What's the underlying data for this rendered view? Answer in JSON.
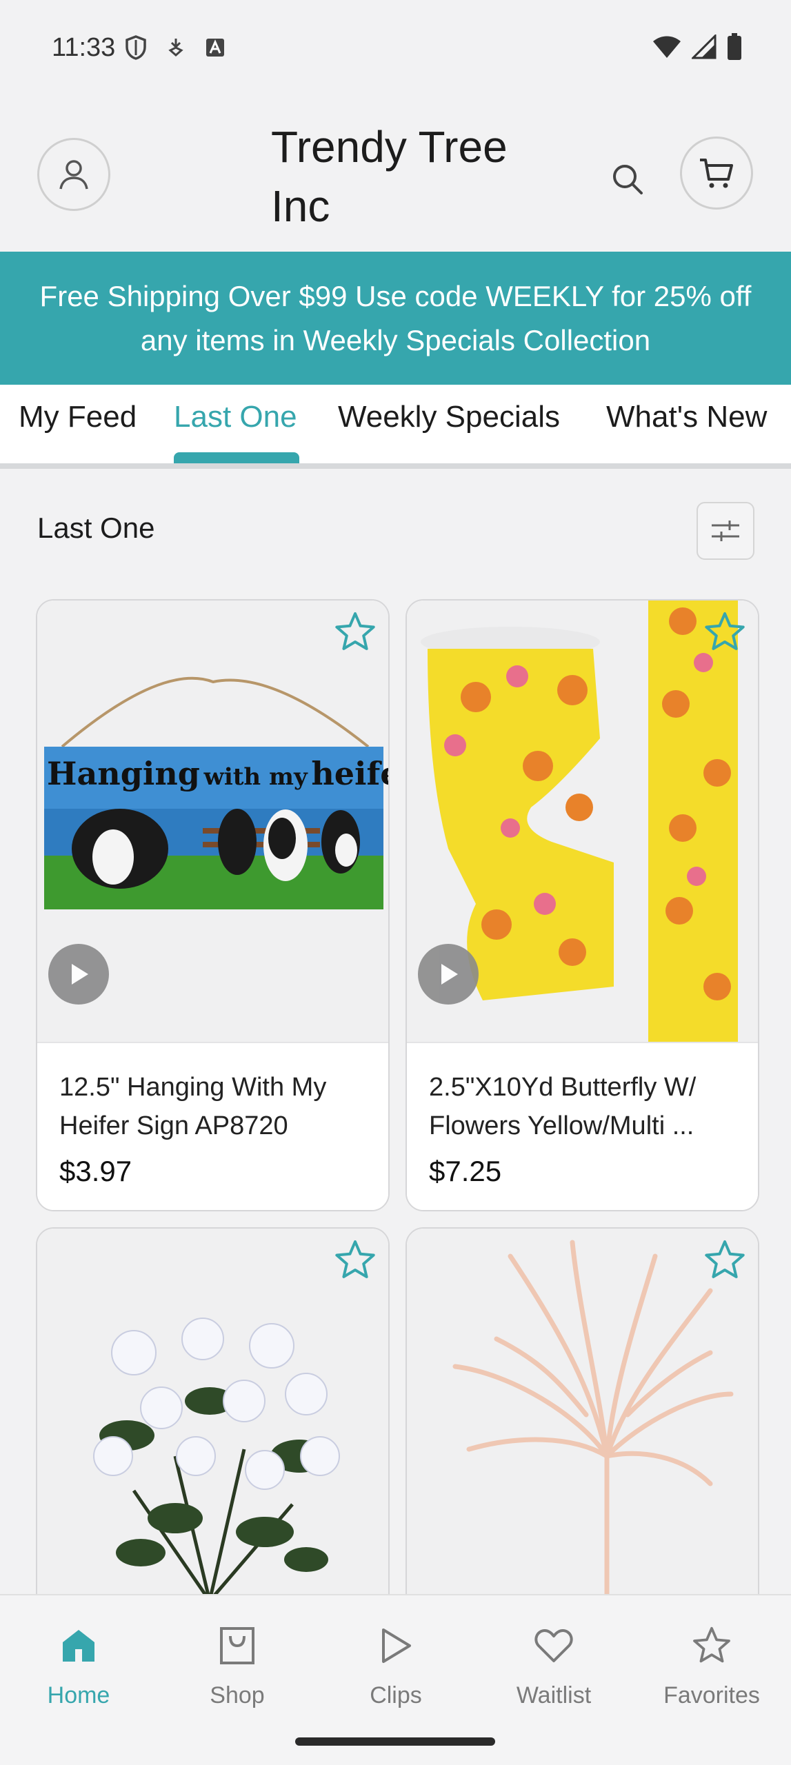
{
  "status_bar": {
    "time": "11:33",
    "left_icons": [
      "shield-icon",
      "download-badge-icon",
      "a-badge-icon"
    ],
    "right_icons": [
      "wifi-icon",
      "signal-icon",
      "battery-icon"
    ]
  },
  "header": {
    "brand": "Trendy Tree Inc",
    "icons": [
      "account-icon",
      "search-icon",
      "cart-icon"
    ]
  },
  "promo": {
    "text": "Free Shipping Over $99 Use code WEEKLY for 25% off any items in Weekly Specials Collection"
  },
  "tabs": [
    {
      "label": "My Feed",
      "active": false
    },
    {
      "label": "Last One",
      "active": true
    },
    {
      "label": "Weekly Specials",
      "active": false
    },
    {
      "label": "What's New",
      "active": false
    }
  ],
  "section": {
    "title": "Last One",
    "filter_icon": "sliders-icon"
  },
  "products": [
    {
      "name": "12.5\" Hanging With My Heifer Sign AP8720",
      "price": "$3.97",
      "sign_text_1": "Hanging",
      "sign_text_2": "with my",
      "sign_text_3": "heifers"
    },
    {
      "name": "2.5\"X10Yd Butterfly W/ Flowers Yellow/Multi ...",
      "price": "$7.25"
    },
    {
      "name": "",
      "price": ""
    },
    {
      "name": "",
      "price": ""
    }
  ],
  "bottom_nav": [
    {
      "label": "Home",
      "icon": "home-icon",
      "active": true
    },
    {
      "label": "Shop",
      "icon": "bag-icon",
      "active": false
    },
    {
      "label": "Clips",
      "icon": "play-icon",
      "active": false
    },
    {
      "label": "Waitlist",
      "icon": "heart-icon",
      "active": false
    },
    {
      "label": "Favorites",
      "icon": "star-icon",
      "active": false
    }
  ],
  "colors": {
    "accent": "#36a6ad",
    "background": "#f2f2f3",
    "nav_inactive": "#7a7a7a"
  }
}
